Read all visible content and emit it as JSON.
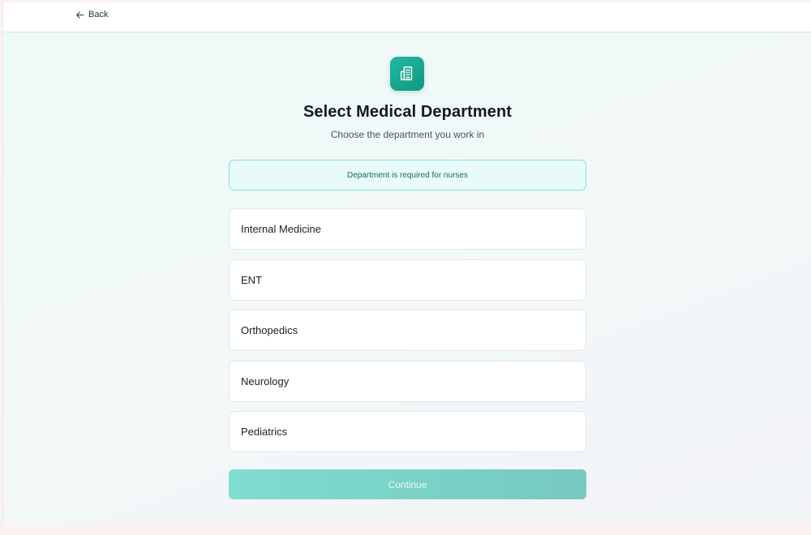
{
  "nav": {
    "back_label": "Back"
  },
  "header": {
    "logo_icon": "hospital-icon",
    "title": "Select Medical Department",
    "subtitle": "Choose the department you work in"
  },
  "notice": {
    "text": "Department is required for nurses"
  },
  "departments": [
    {
      "label": "Internal Medicine"
    },
    {
      "label": "ENT"
    },
    {
      "label": "Orthopedics"
    },
    {
      "label": "Neurology"
    },
    {
      "label": "Pediatrics"
    }
  ],
  "actions": {
    "continue_label": "Continue"
  },
  "colors": {
    "accent": "#14a78f",
    "notice_border": "#86e2d4",
    "button": "#7fdccf"
  }
}
